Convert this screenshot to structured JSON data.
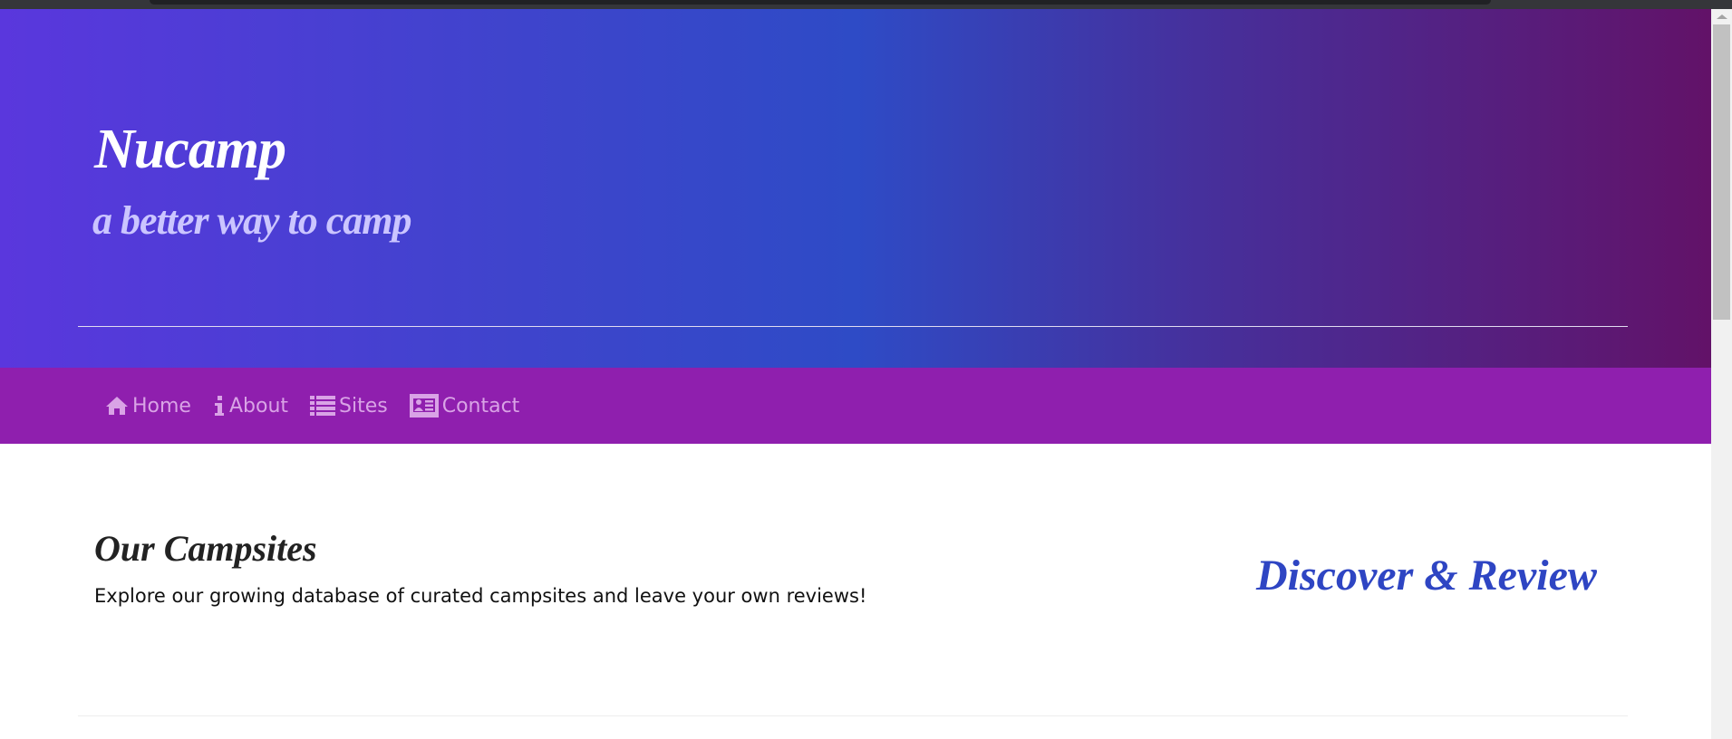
{
  "header": {
    "brand": "Nucamp",
    "tagline": "a better way to camp"
  },
  "nav": {
    "items": [
      {
        "label": "Home",
        "icon": "home-icon"
      },
      {
        "label": "About",
        "icon": "info-icon"
      },
      {
        "label": "Sites",
        "icon": "list-icon"
      },
      {
        "label": "Contact",
        "icon": "address-card-icon"
      }
    ]
  },
  "main": {
    "title": "Our Campsites",
    "description": "Explore our growing database of curated campsites and leave your own reviews!",
    "tagline": "Discover & Review"
  },
  "colors": {
    "gradient_start": "#5a37dd",
    "gradient_mid": "#2e4bc6",
    "gradient_end": "#621268",
    "nav": "#8f1fae",
    "nav_text": "#d9a3e6",
    "accent": "#2e45c3"
  }
}
